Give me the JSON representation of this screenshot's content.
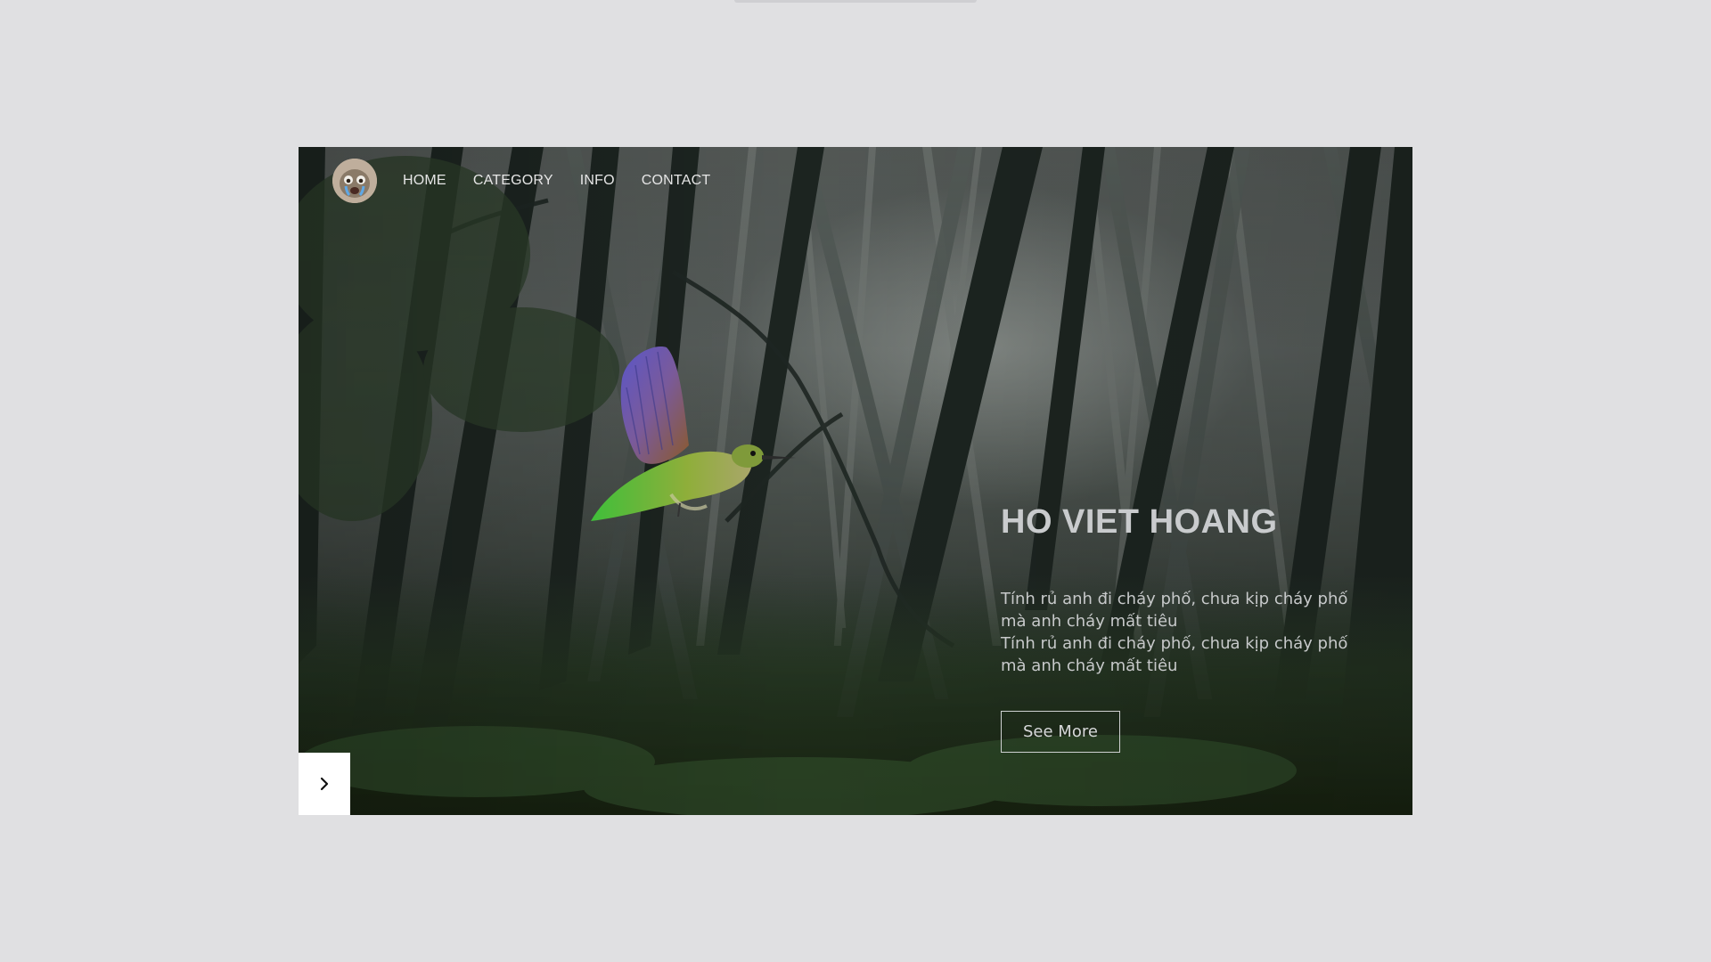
{
  "nav": {
    "avatar_icon": "avatar-face-icon",
    "links": [
      {
        "label": "HOME"
      },
      {
        "label": "CATEGORY"
      },
      {
        "label": "INFO"
      },
      {
        "label": "CONTACT"
      }
    ]
  },
  "hero": {
    "title": "HO VIET HOANG",
    "description_lines": [
      "Tính rủ anh đi cháy phố, chưa kịp cháy phố",
      "mà anh cháy mất tiêu",
      "Tính rủ anh đi cháy phố, chưa kịp cháy phố",
      "mà anh cháy mất tiêu"
    ],
    "button_label": "See More",
    "next_icon": "chevron-right-icon"
  },
  "colors": {
    "page_background": "#e0e0e2",
    "text": "#c9cbcd",
    "button_border": "#cfd1d2",
    "next_button_bg": "#ffffff"
  }
}
